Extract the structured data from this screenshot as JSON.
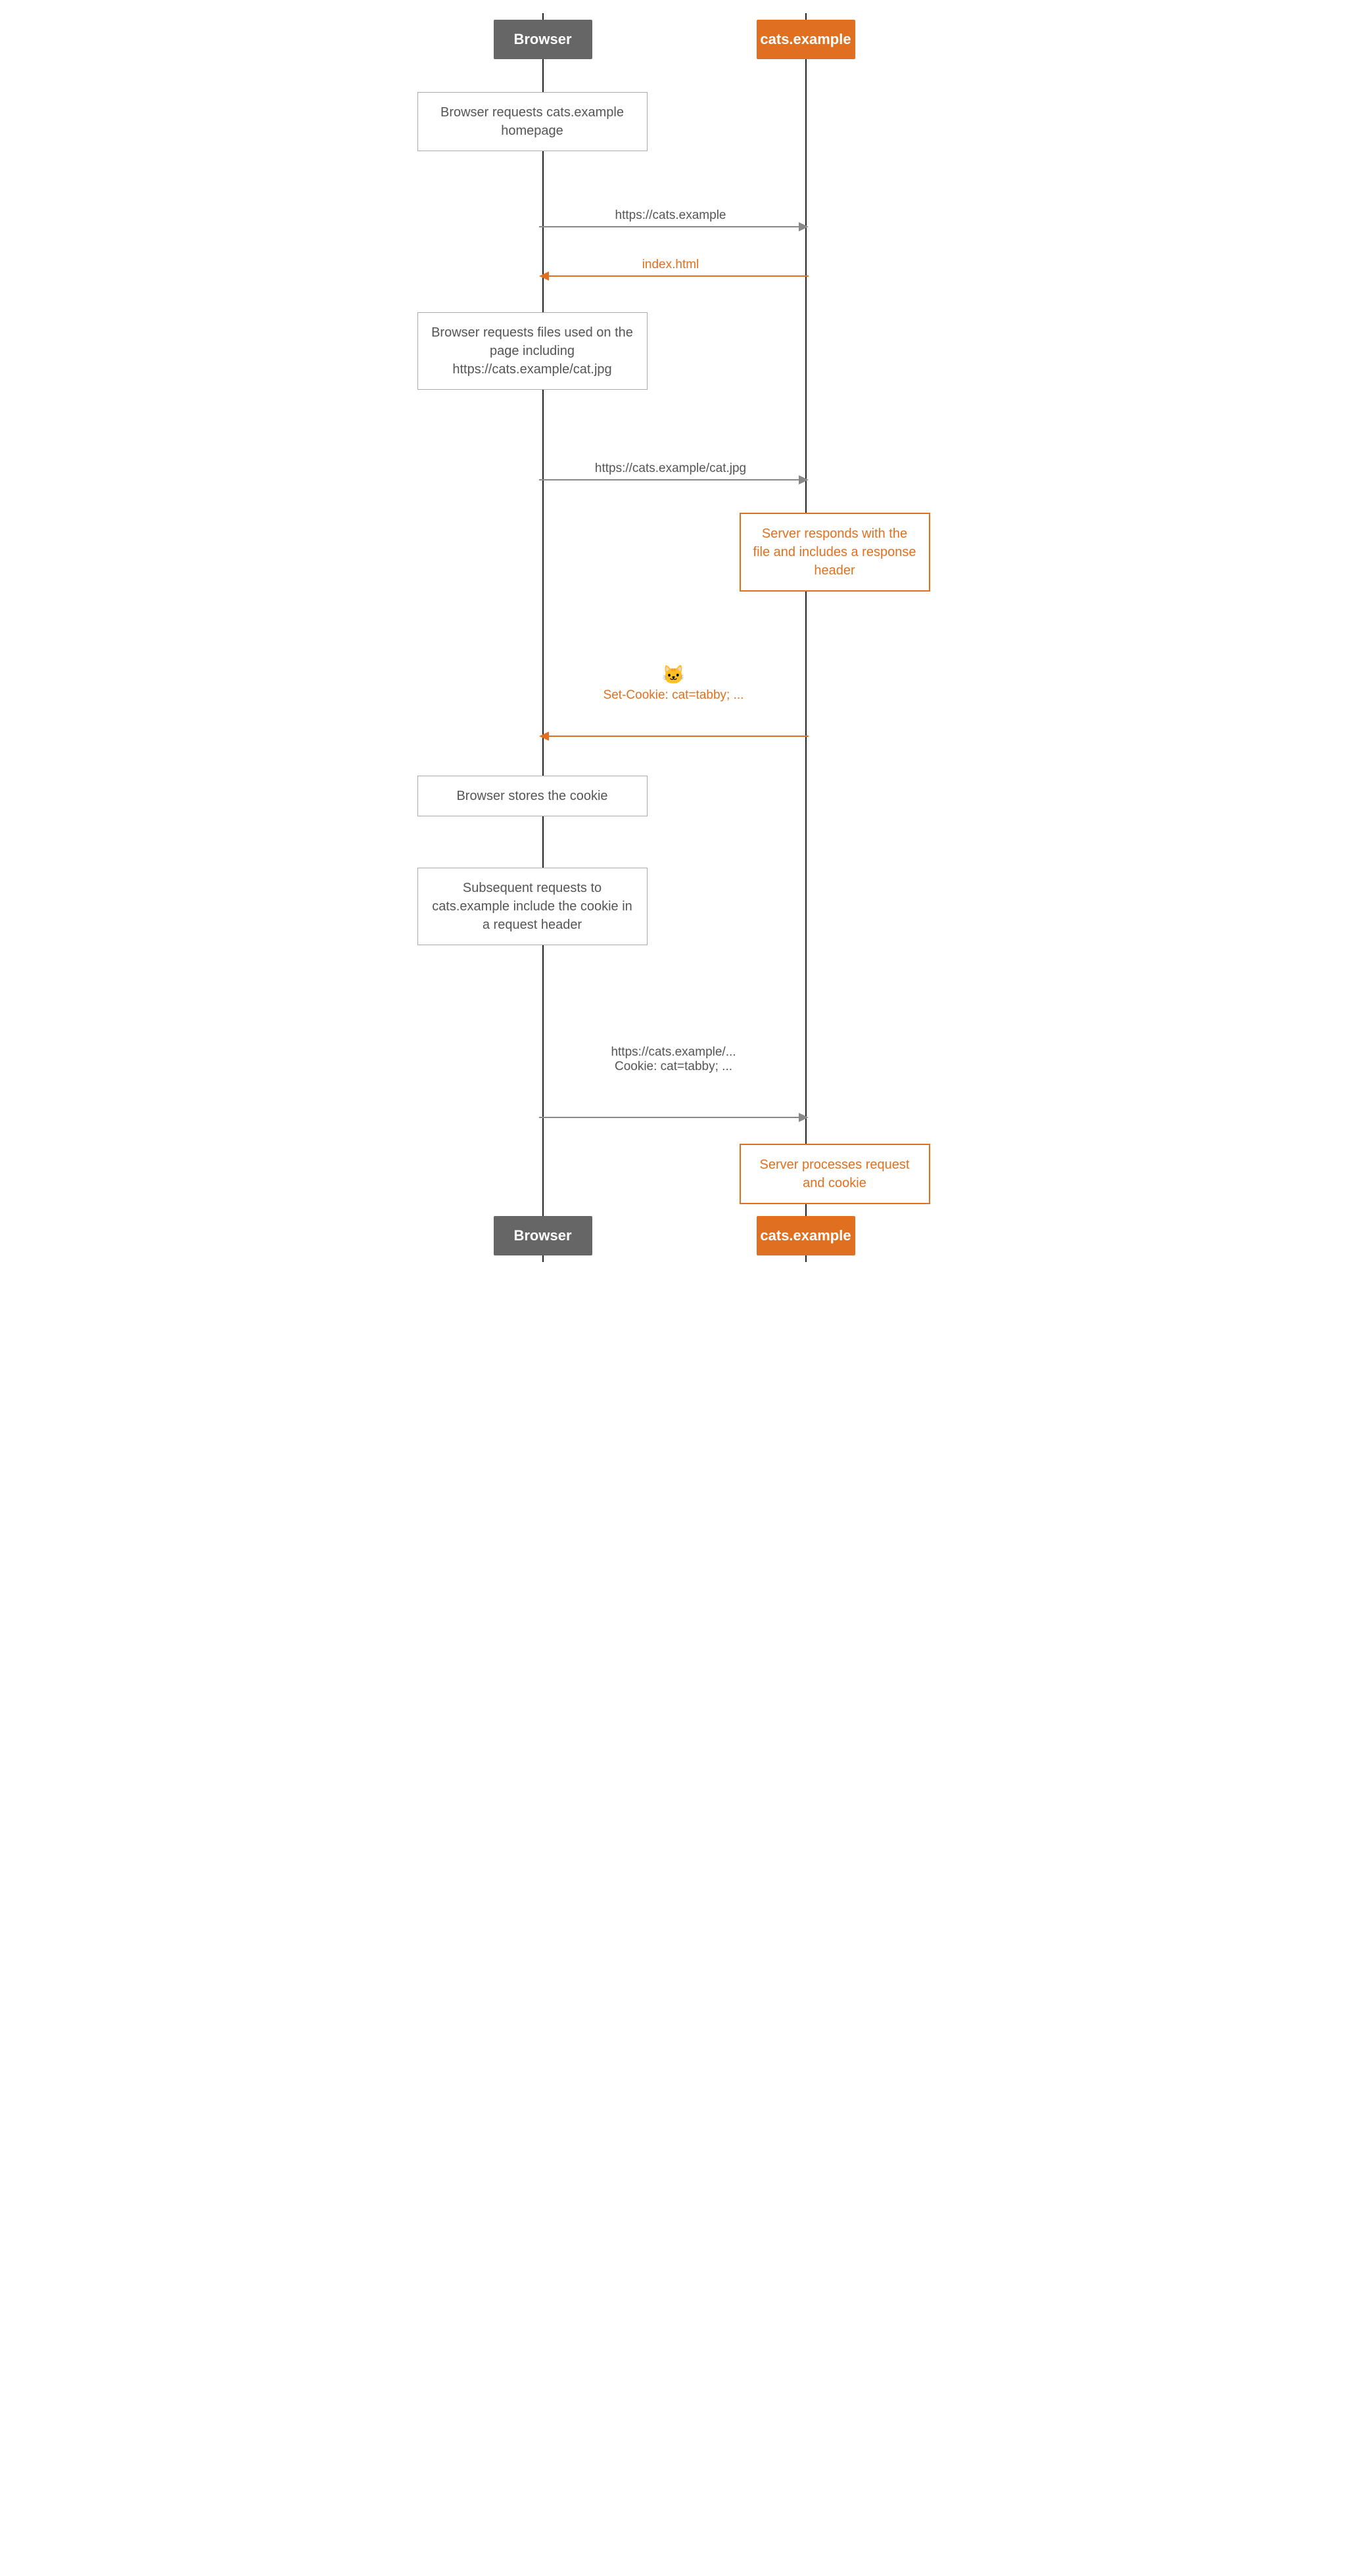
{
  "actors": {
    "browser_label": "Browser",
    "server_label": "cats.example"
  },
  "notes": {
    "note1": "Browser requests cats.example homepage",
    "note2": "Browser requests files used on the page including https://cats.example/cat.jpg",
    "note3": "Server responds with the file and includes a response header",
    "note4": "Browser stores the cookie",
    "note5": "Subsequent requests to cats.example include the cookie in a request header",
    "note6": "Server processes request and cookie"
  },
  "arrows": {
    "arrow1_label": "https://cats.example",
    "arrow2_label": "index.html",
    "arrow3_label": "https://cats.example/cat.jpg",
    "arrow4_emoji": "🐱",
    "arrow4_label": "Set-Cookie: cat=tabby; ...",
    "arrow5_label1": "https://cats.example/...",
    "arrow5_label2": "Cookie: cat=tabby; ..."
  }
}
